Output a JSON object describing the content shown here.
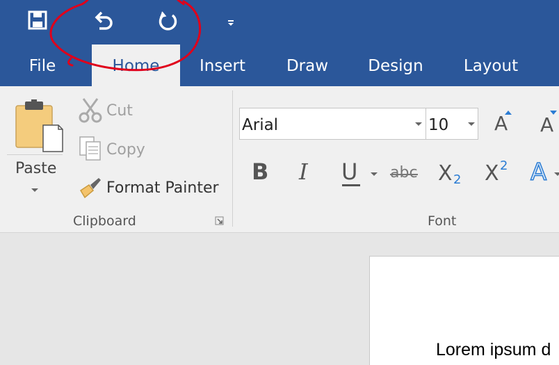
{
  "quick_access": {
    "save_icon": "save-icon",
    "undo_icon": "undo-icon",
    "redo_icon": "redo-icon",
    "customize_icon": "customize-dropdown-icon"
  },
  "tabs": [
    {
      "label": "File",
      "active": false
    },
    {
      "label": "Home",
      "active": true
    },
    {
      "label": "Insert",
      "active": false
    },
    {
      "label": "Draw",
      "active": false
    },
    {
      "label": "Design",
      "active": false
    },
    {
      "label": "Layout",
      "active": false
    }
  ],
  "clipboard": {
    "paste_label": "Paste",
    "cut_label": "Cut",
    "copy_label": "Copy",
    "format_painter_label": "Format Painter",
    "group_label": "Clipboard"
  },
  "font": {
    "font_name": "Arial",
    "font_size": "10",
    "bold": "B",
    "italic": "I",
    "underline": "U",
    "strikethrough": "abc",
    "subscript_base": "X",
    "subscript_mark": "2",
    "superscript_base": "X",
    "superscript_mark": "2",
    "grow_font": "A",
    "shrink_font": "A",
    "text_effects": "A",
    "group_label": "Font"
  },
  "document": {
    "text": "Lorem ipsum d"
  },
  "colors": {
    "ribbon_blue": "#2b579a",
    "annotation_red": "#e0001b"
  }
}
